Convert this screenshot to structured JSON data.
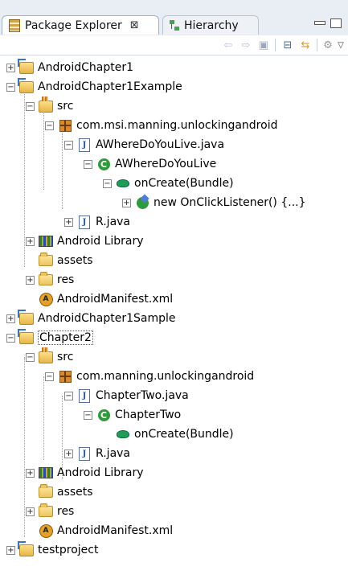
{
  "tabs": [
    {
      "label": "Package Explorer",
      "close": "⊠",
      "active": true
    },
    {
      "label": "Hierarchy",
      "active": false
    }
  ],
  "toolbar_icons": [
    "back-arrow-icon",
    "forward-arrow-icon",
    "go-into-icon",
    "collapse-all-icon",
    "link-with-editor-icon",
    "view-menu-icon",
    "dropdown-triangle-icon"
  ],
  "tree": [
    {
      "label": "AndroidChapter1",
      "icon": "project-icon",
      "expanded": false
    },
    {
      "label": "AndroidChapter1Example",
      "icon": "project-icon",
      "expanded": true
    },
    {
      "label": "src",
      "icon": "source-folder-icon",
      "expanded": true
    },
    {
      "label": "com.msi.manning.unlockingandroid",
      "icon": "package-icon",
      "expanded": true
    },
    {
      "label": "AWhereDoYouLive.java",
      "icon": "java-file-icon",
      "expanded": true
    },
    {
      "label": "AWhereDoYouLive",
      "icon": "class-icon",
      "expanded": true
    },
    {
      "label": "onCreate(Bundle)",
      "icon": "method-icon",
      "expanded": true
    },
    {
      "label": "new OnClickListener() {...}",
      "icon": "anonymous-class-icon",
      "expanded": false
    },
    {
      "label": "R.java",
      "icon": "java-file-icon",
      "expanded": false
    },
    {
      "label": "Android Library",
      "icon": "library-icon",
      "expanded": false
    },
    {
      "label": "assets",
      "icon": "folder-icon"
    },
    {
      "label": "res",
      "icon": "folder-icon",
      "expanded": false
    },
    {
      "label": "AndroidManifest.xml",
      "icon": "manifest-icon"
    },
    {
      "label": "AndroidChapter1Sample",
      "icon": "project-icon",
      "expanded": false
    },
    {
      "label": "Chapter2",
      "icon": "project-icon",
      "expanded": true,
      "selected": true
    },
    {
      "label": "src",
      "icon": "source-folder-icon",
      "expanded": true
    },
    {
      "label": "com.manning.unlockingandroid",
      "icon": "package-icon",
      "expanded": true
    },
    {
      "label": "ChapterTwo.java",
      "icon": "java-file-icon",
      "expanded": true
    },
    {
      "label": "ChapterTwo",
      "icon": "class-icon",
      "expanded": true
    },
    {
      "label": "onCreate(Bundle)",
      "icon": "method-icon"
    },
    {
      "label": "R.java",
      "icon": "java-file-icon",
      "expanded": false
    },
    {
      "label": "Android Library",
      "icon": "library-icon",
      "expanded": false
    },
    {
      "label": "assets",
      "icon": "folder-icon"
    },
    {
      "label": "res",
      "icon": "folder-icon",
      "expanded": false
    },
    {
      "label": "AndroidManifest.xml",
      "icon": "manifest-icon"
    },
    {
      "label": "testproject",
      "icon": "project-icon",
      "expanded": false
    }
  ]
}
